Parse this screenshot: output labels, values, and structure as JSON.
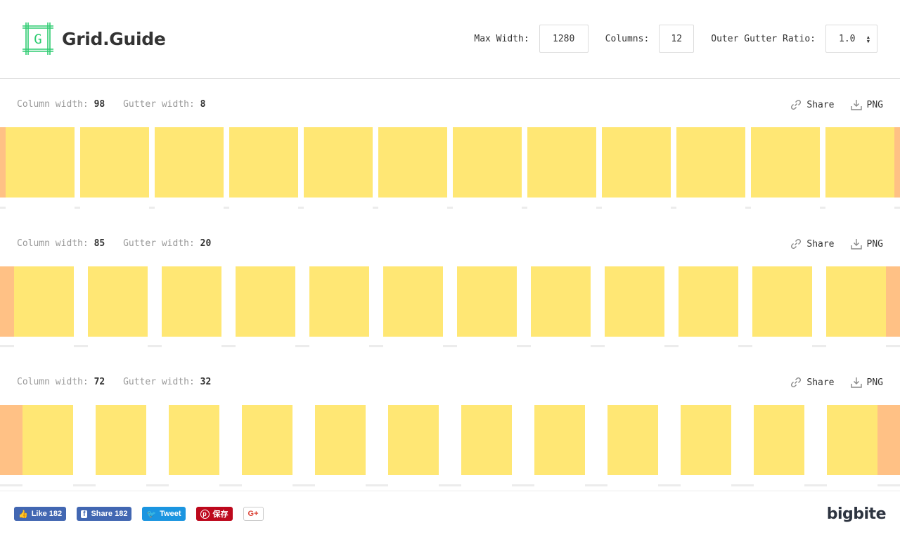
{
  "header": {
    "logo_letter": "G",
    "logo_text": "Grid.Guide",
    "logo_color": "#2ecc71",
    "max_width_label": "Max Width:",
    "max_width_value": "1280",
    "columns_label": "Columns:",
    "columns_value": "12",
    "ratio_label": "Outer Gutter Ratio:",
    "ratio_value": "1.0"
  },
  "labels": {
    "column_width": "Column width:",
    "gutter_width": "Gutter width:",
    "share": "Share",
    "png": "PNG"
  },
  "colors": {
    "column": "#ffe774",
    "outer_gutter": "#ffc185",
    "ruler": "#ececec"
  },
  "grids": [
    {
      "column_width": "98",
      "gutter_width": "8"
    },
    {
      "column_width": "85",
      "gutter_width": "20"
    },
    {
      "column_width": "72",
      "gutter_width": "32"
    }
  ],
  "footer": {
    "like": "Like 182",
    "share": "Share 182",
    "tweet": "Tweet",
    "pin": "保存",
    "gplus": "G+",
    "brand": "bigbite"
  }
}
